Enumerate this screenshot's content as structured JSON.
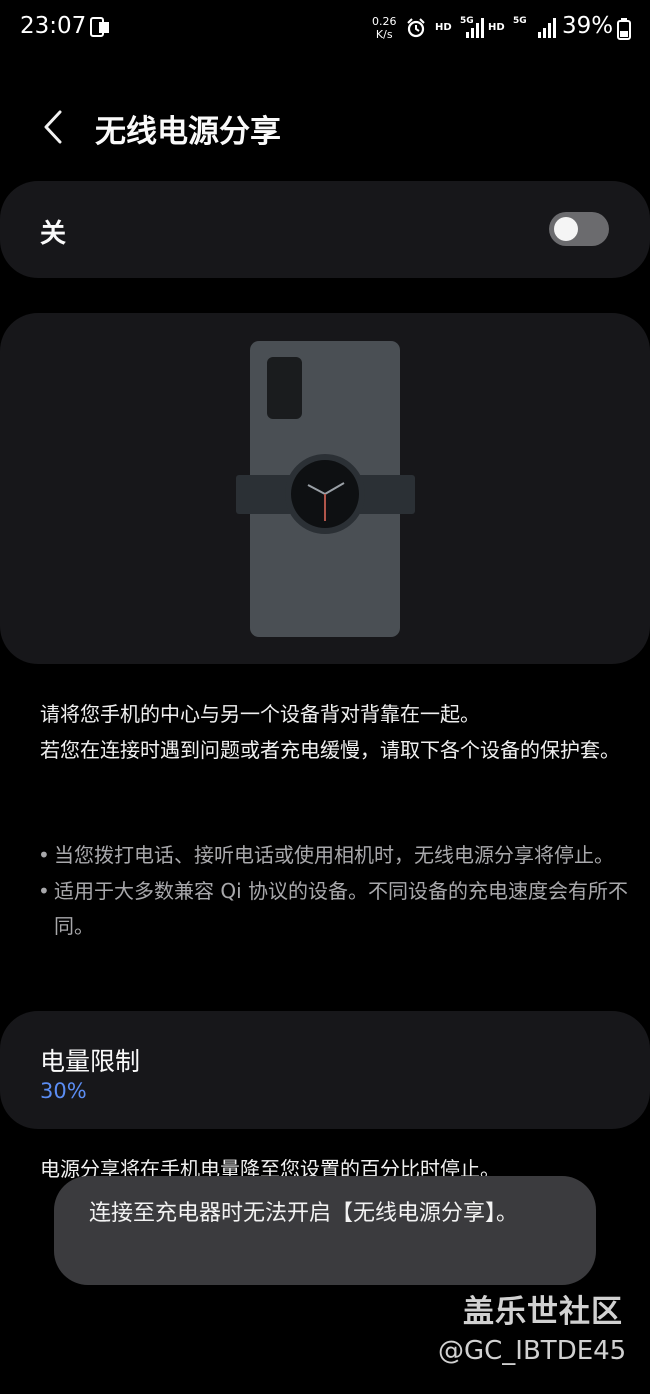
{
  "status_bar": {
    "time": "23:07",
    "speed_value": "0.26",
    "speed_unit": "K/s",
    "hd1": "HD",
    "net1": "5G",
    "hd2": "HD",
    "net2": "5G",
    "battery": "39%"
  },
  "header": {
    "title": "无线电源分享",
    "back_icon": "chevron-left-icon"
  },
  "toggle": {
    "label": "关",
    "state": "off"
  },
  "illustration": {
    "phone_color": "#4a4f54",
    "watch_color": "#2b3035"
  },
  "description": {
    "line1": "请将您手机的中心与另一个设备背对背靠在一起。",
    "line2": "若您在连接时遇到问题或者充电缓慢，请取下各个设备的保护套。"
  },
  "notes": [
    {
      "bullet": "•",
      "text": "当您拨打电话、接听电话或使用相机时，无线电源分享将停止。"
    },
    {
      "bullet": "•",
      "text": "适用于大多数兼容 Qi 协议的设备。不同设备的充电速度会有所不同。"
    }
  ],
  "battery_limit": {
    "title": "电量限制",
    "value": "30%",
    "value_color": "#5b8df3"
  },
  "footer_text": "电源分享将在手机电量降至您设置的百分比时停止。",
  "toast": {
    "text": "连接至充电器时无法开启【无线电源分享】。"
  },
  "watermark": {
    "line1": "盖乐世社区",
    "line2": "@GC_IBTDE45"
  }
}
